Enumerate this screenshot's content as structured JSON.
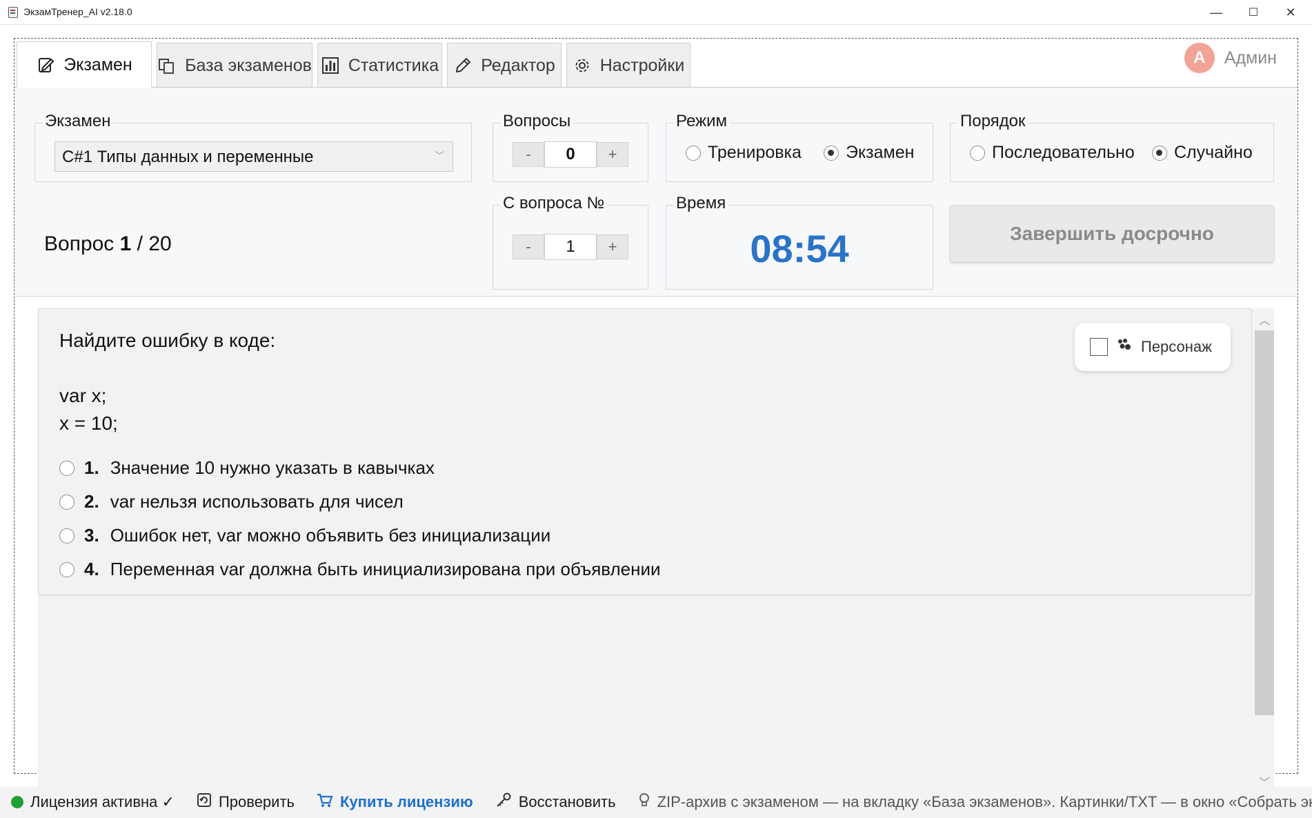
{
  "window": {
    "title": "ЭкзамТренер_AI v2.18.0",
    "minimize": "—",
    "maximize": "☐",
    "close": "✕"
  },
  "tabs": [
    {
      "label": "Экзамен",
      "icon": "edit-document-icon",
      "active": true
    },
    {
      "label": "База экзаменов",
      "icon": "copy-files-icon",
      "active": false
    },
    {
      "label": "Статистика",
      "icon": "bar-chart-icon",
      "active": false
    },
    {
      "label": "Редактор",
      "icon": "pencil-icon",
      "active": false
    },
    {
      "label": "Настройки",
      "icon": "gear-icon",
      "active": false
    }
  ],
  "user": {
    "initial": "A",
    "name": "Админ",
    "avatar_color": "#f1a395"
  },
  "exam": {
    "label": "Экзамен",
    "selected": "C#1 Типы данных и переменные"
  },
  "questions_count": {
    "label": "Вопросы",
    "minus": "-",
    "value": "0",
    "plus": "+"
  },
  "start_from": {
    "label": "С вопроса №",
    "minus": "-",
    "value": "1",
    "plus": "+"
  },
  "mode": {
    "label": "Режим",
    "options": [
      "Тренировка",
      "Экзамен"
    ],
    "selected": "Экзамен"
  },
  "order": {
    "label": "Порядок",
    "options": [
      "Последовательно",
      "Случайно"
    ],
    "selected": "Случайно"
  },
  "progress": {
    "prefix": "Вопрос",
    "current": "1",
    "separator": " / ",
    "total": "20"
  },
  "time": {
    "label": "Время",
    "value": "08:54",
    "color": "#2a73c7"
  },
  "finish_button": "Завершить досрочно",
  "question": {
    "text": "Найдите ошибку в коде:\n\nvar x;\nx = 10;",
    "answers": [
      {
        "num": "1.",
        "text": "Значение 10 нужно указать в кавычках"
      },
      {
        "num": "2.",
        "text": "var нельзя использовать для чисел"
      },
      {
        "num": "3.",
        "text": "Ошибок нет, var можно объявить без инициализации"
      },
      {
        "num": "4.",
        "text": "Переменная var должна быть инициализирована при объявлении"
      }
    ]
  },
  "persona": {
    "label": "Персонаж",
    "checked": false,
    "icon": "paw-icon"
  },
  "statusbar": {
    "license": "Лицензия активна ✓",
    "license_color": "#21a036",
    "check": "Проверить",
    "buy": "Купить лицензию",
    "restore": "Восстановить",
    "hint": "ZIP-архив с экзаменом — на вкладку «База экзаменов». Картинки/TXT — в окно «Собрать экзаме"
  }
}
